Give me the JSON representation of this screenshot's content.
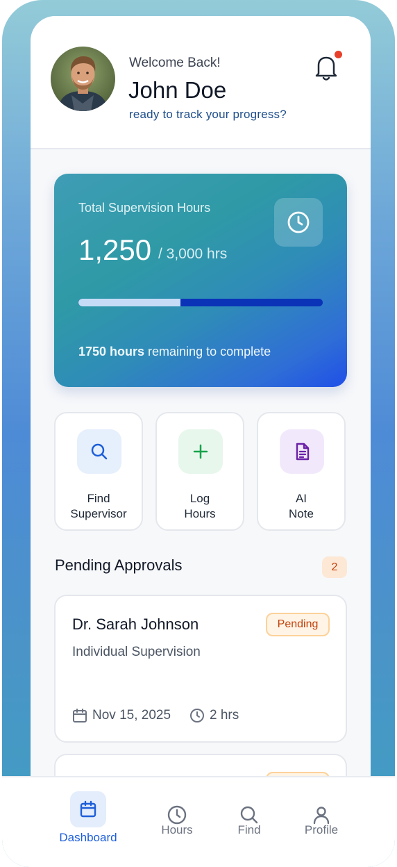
{
  "header": {
    "welcome": "Welcome Back!",
    "name": "John Doe",
    "tagline": "ready to track your progress?",
    "has_notification": true
  },
  "hours_card": {
    "title": "Total Supervision Hours",
    "value": "1,250",
    "total": "/ 3,000 hrs",
    "progress": 0.4167,
    "remaining_bold": "1750 hours",
    "remaining_rest": " remaining to complete"
  },
  "quick_actions": [
    {
      "label": "Find\nSupervisor",
      "icon": "search-icon",
      "color": "#1d5ed8",
      "bg": "#e6effc"
    },
    {
      "label": "Log\nHours",
      "icon": "plus-icon",
      "color": "#16a34a",
      "bg": "#e7f7ec"
    },
    {
      "label": "AI\nNote",
      "icon": "document-icon",
      "color": "#6b21a8",
      "bg": "#f1e9fb"
    }
  ],
  "pending": {
    "title": "Pending Approvals",
    "count": "2",
    "items": [
      {
        "name": "Dr. Sarah Johnson",
        "type": "Individual Supervision",
        "status": "Pending",
        "date": "Nov 15, 2025",
        "duration": "2 hrs"
      }
    ]
  },
  "tabs": [
    {
      "label": "Dashboard",
      "icon": "calendar-icon",
      "active": true
    },
    {
      "label": "Hours",
      "icon": "clock-icon",
      "active": false
    },
    {
      "label": "Find",
      "icon": "search-icon",
      "active": false
    },
    {
      "label": "Profile",
      "icon": "user-icon",
      "active": false
    }
  ],
  "colors": {
    "accent": "#1d5ed8",
    "pending_text": "#c2410c",
    "pending_bg": "#fff4e5"
  }
}
